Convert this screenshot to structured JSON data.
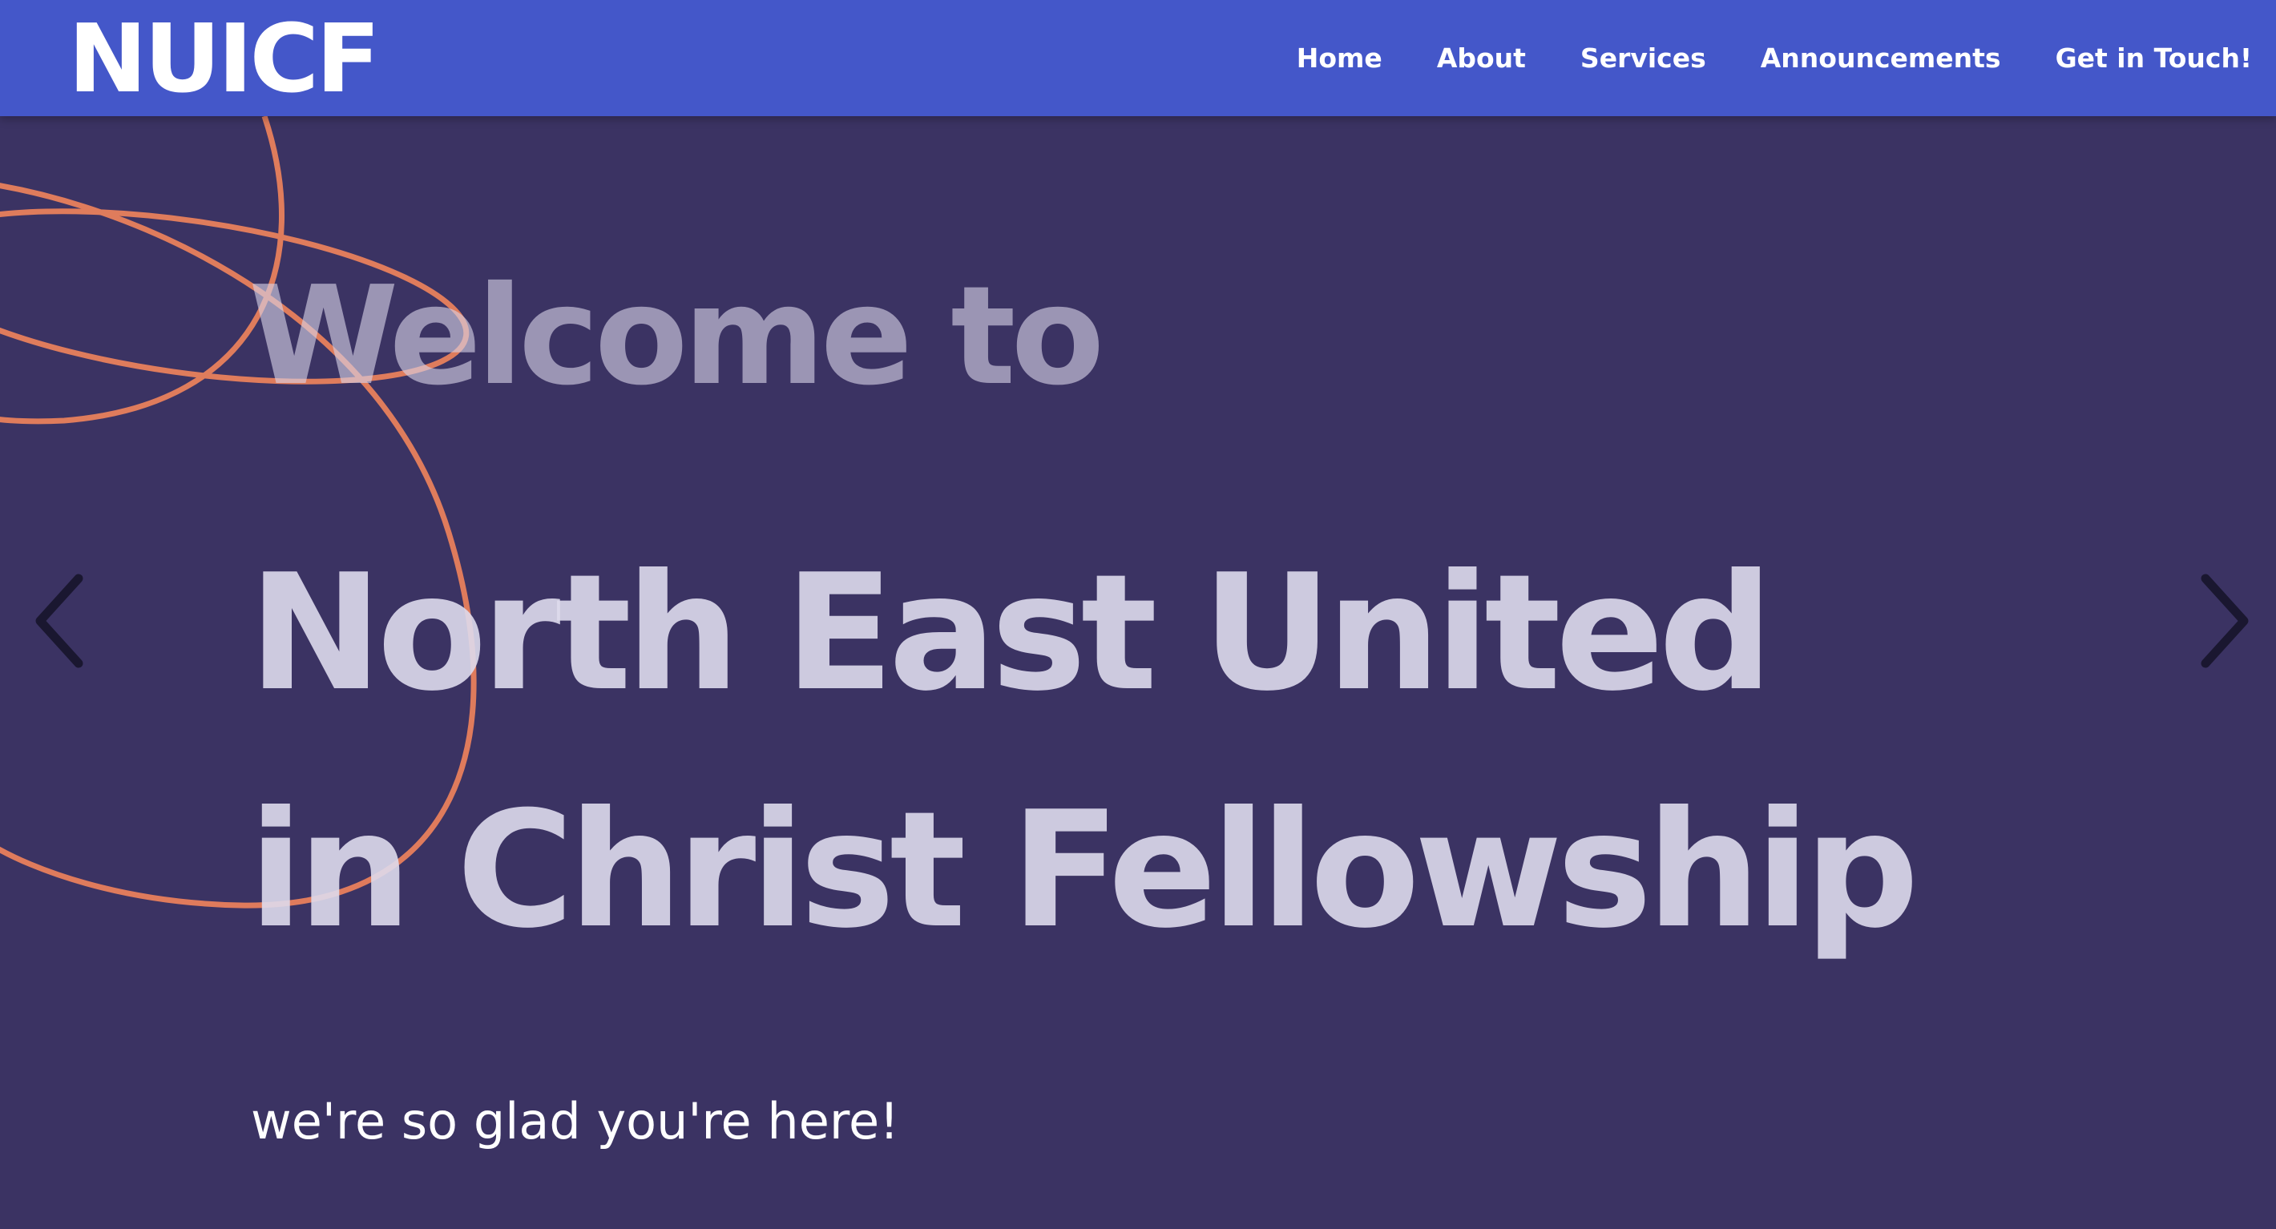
{
  "navbar": {
    "brand": "NUICF",
    "links": [
      {
        "label": "Home"
      },
      {
        "label": "About"
      },
      {
        "label": "Services"
      },
      {
        "label": "Announcements"
      },
      {
        "label": "Get in Touch!"
      }
    ],
    "color": "#4457c9"
  },
  "hero": {
    "welcome": "Welcome to",
    "title": "North East United in Christ Fellowship",
    "subtitle": "we're so glad you're here!",
    "background": "#3b3363",
    "accent": "#e8805c",
    "prev_icon": "chevron-left-icon",
    "next_icon": "chevron-right-icon"
  }
}
